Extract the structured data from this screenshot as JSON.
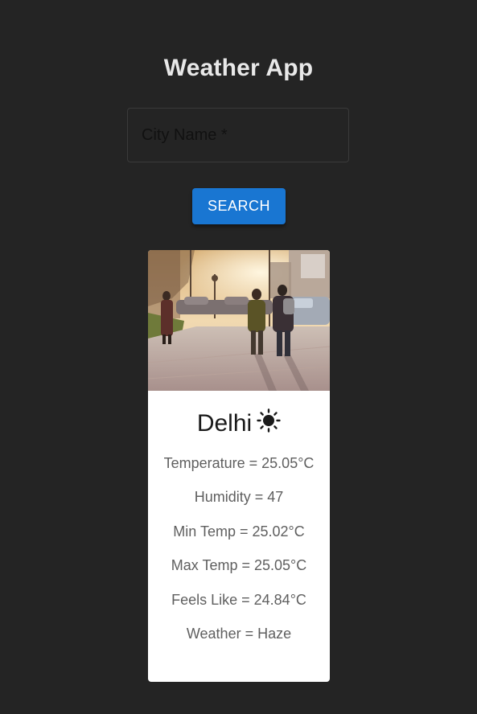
{
  "app": {
    "title": "Weather App"
  },
  "search": {
    "placeholder": "City Name *",
    "value": "",
    "button_label": "SEARCH"
  },
  "card": {
    "image_description_icon": "street-photo",
    "city": "Delhi",
    "weather_icon": "sun-icon",
    "stats": [
      "Temperature = 25.05°C",
      "Humidity = 47",
      "Min Temp = 25.02°C",
      "Max Temp = 25.05°C",
      "Feels Like = 24.84°C",
      "Weather = Haze"
    ]
  },
  "colors": {
    "background": "#242424",
    "accent": "#1976d2",
    "card": "#ffffff"
  }
}
